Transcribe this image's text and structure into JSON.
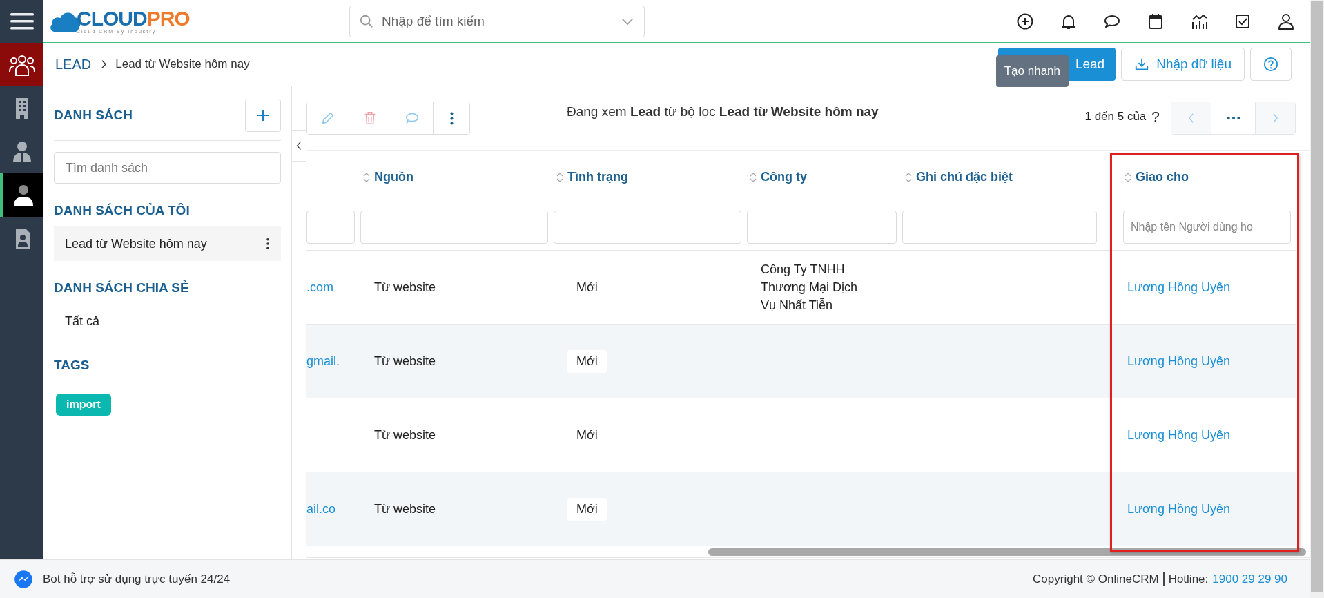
{
  "header": {
    "logo_main": "CLOUD",
    "logo_accent": "PRO",
    "logo_tagline": "Cloud CRM By Industry",
    "search_placeholder": "Nhập để tìm kiếm",
    "tooltip": "Tạo nhanh"
  },
  "rail": [
    {
      "kind": "people",
      "selected": false
    },
    {
      "kind": "building",
      "selected": false
    },
    {
      "kind": "contact",
      "selected": false
    },
    {
      "kind": "lead",
      "selected": true
    },
    {
      "kind": "document",
      "selected": false
    }
  ],
  "breadcrumb": {
    "module": "LEAD",
    "current": "Lead từ Website hôm nay"
  },
  "actions": [
    {
      "kind": "primary",
      "label": "Lead"
    },
    {
      "kind": "import",
      "label": "Nhập dữ liệu"
    },
    {
      "kind": "help"
    }
  ],
  "lists_panel": {
    "title": "DANH SÁCH",
    "search_placeholder": "Tìm danh sách",
    "sections": [
      {
        "title": "DANH SÁCH CỦA TÔI",
        "items": [
          {
            "label": "Lead từ Website hôm nay",
            "selected": true
          }
        ]
      },
      {
        "title": "DANH SÁCH CHIA SẺ",
        "items": [
          {
            "label": "Tất cả",
            "selected": false
          }
        ]
      }
    ],
    "tags_title": "TAGS",
    "tags": [
      {
        "label": "import",
        "color": "#0bb8b0"
      }
    ]
  },
  "toolbar": {
    "view_text": "Đang xem **Lead** từ bộ lọc **Lead từ Website hôm nay**",
    "range": "1 đến 5 của",
    "total": "?"
  },
  "table": {
    "columns": [
      {
        "label": "Nguồn",
        "highlighted": false
      },
      {
        "label": "Tình trạng",
        "highlighted": false
      },
      {
        "label": "Công ty",
        "highlighted": false
      },
      {
        "label": "Ghi chú đặc biệt",
        "highlighted": false
      },
      {
        "label": "Giao cho",
        "highlighted": true,
        "filter_placeholder": "Nhập tên Người dùng ho"
      }
    ],
    "rows": [
      {
        "column_1": ".com",
        "source": "Từ website",
        "status": "Mới",
        "company": "Công Ty TNHH Thương Mại Dịch Vụ Nhất Tiễn",
        "assignee": "Lương Hồng Uyên"
      },
      {
        "column_1": "gmail.",
        "source": "Từ website",
        "status": "Mới",
        "assignee": "Lương Hồng Uyên"
      },
      {
        "source": "Từ website",
        "status": "Mới",
        "assignee": "Lương Hồng Uyên"
      },
      {
        "column_1": "ail.co",
        "source": "Từ website",
        "status": "Mới",
        "assignee": "Lương Hồng Uyên"
      }
    ]
  },
  "footer": {
    "bot": "Bot hỗ trợ sử dụng trực tuyến 24/24",
    "copyright": "Copyright © OnlineCRM",
    "hotline_label": "Hotline:",
    "hotline": "1900 29 29 90"
  }
}
